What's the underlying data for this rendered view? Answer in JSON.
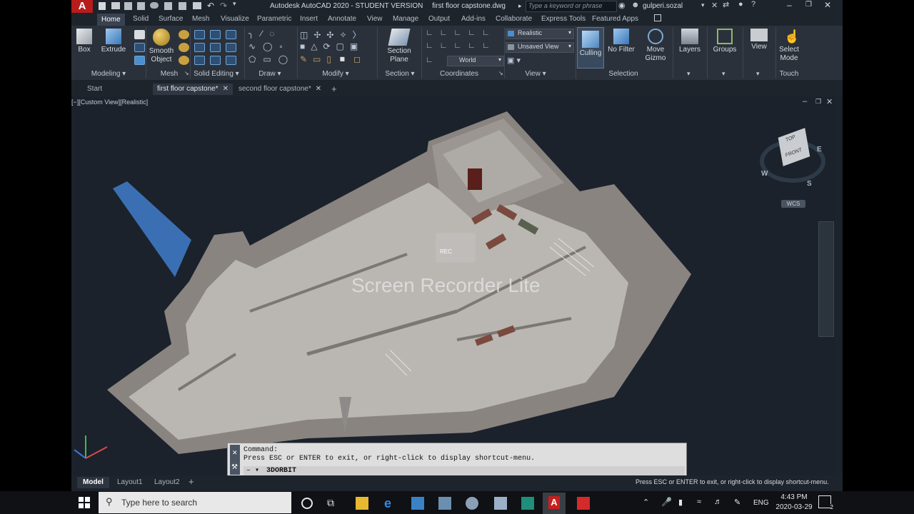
{
  "titlebar": {
    "app_title": "Autodesk AutoCAD 2020 - STUDENT VERSION",
    "doc_title": "first floor capstone.dwg",
    "search_placeholder": "Type a keyword or phrase",
    "user": "gulperi.sozal"
  },
  "ribbon_tabs": [
    "Home",
    "Solid",
    "Surface",
    "Mesh",
    "Visualize",
    "Parametric",
    "Insert",
    "Annotate",
    "View",
    "Manage",
    "Output",
    "Add-ins",
    "Collaborate",
    "Express Tools",
    "Featured Apps"
  ],
  "ribbon": {
    "box": "Box",
    "extrude": "Extrude",
    "smooth_object": "Smooth Object",
    "section_plane": "Section Plane",
    "visual_style": "Realistic",
    "view": "Unsaved View",
    "ucs": "World",
    "culling": "Culling",
    "no_filter": "No Filter",
    "move_gizmo": "Move Gizmo",
    "layers": "Layers",
    "groups": "Groups",
    "view_btn": "View",
    "select_mode": "Select Mode",
    "panels": {
      "modeling": "Modeling",
      "mesh": "Mesh",
      "solid_editing": "Solid Editing",
      "draw": "Draw",
      "modify": "Modify",
      "section": "Section",
      "coordinates": "Coordinates",
      "view": "View",
      "selection": "Selection",
      "touch": "Touch"
    }
  },
  "doc_tabs": [
    "Start",
    "first floor capstone*",
    "second floor capstone*"
  ],
  "viewport": {
    "label": "[−][Custom View][Realistic]",
    "viewcube_top": "TOP",
    "viewcube_front": "FRONT",
    "compass": {
      "e": "E",
      "s": "S",
      "w": "W"
    },
    "wcs": "WCS",
    "overlay": "Screen Recorder Lite",
    "rec": "REC"
  },
  "command": {
    "line1": "Command:",
    "line2": "Press ESC or ENTER to exit, or right-click to display shortcut-menu.",
    "input": "3DORBIT"
  },
  "model_tabs": [
    "Model",
    "Layout1",
    "Layout2"
  ],
  "status_message": "Press ESC or ENTER to exit, or right-click to display shortcut-menu.",
  "taskbar": {
    "search_placeholder": "Type here to search",
    "lang": "ENG",
    "time": "4:43 PM",
    "date": "2020-03-29",
    "notif_count": "2"
  },
  "colors": {
    "accent": "#e02020",
    "ribbon": "#2b313a",
    "viewport": "#1b222c"
  }
}
